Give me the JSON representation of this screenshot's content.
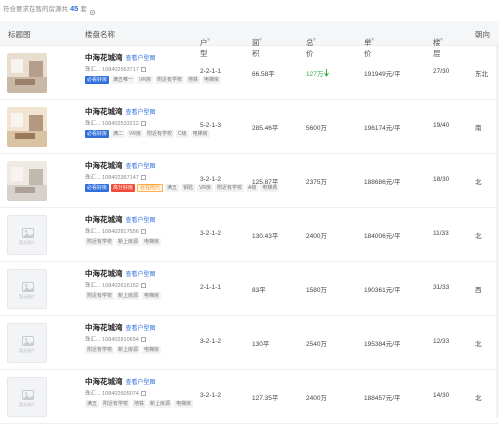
{
  "topbar": {
    "prefix": "符合要求在售的房源共",
    "count": "45",
    "suffix": "套"
  },
  "columns": {
    "image": "标题图",
    "name": "楼盘名称",
    "layout": "户型",
    "area": "面积",
    "total": "总价",
    "unit": "单价",
    "floor": "楼层",
    "orient": "朝向"
  },
  "layout_link_label": "查看户型图",
  "placeholder_label": "暂无图片",
  "listings": [
    {
      "name": "中海花城湾",
      "id": "珠汇... 108402563717",
      "layout": "2-2-1-1",
      "area": "66.58平",
      "total": "127万",
      "price_down": true,
      "unit": "191949元/平",
      "floor": "27/30",
      "orient": "东北",
      "image": "photo",
      "tags": [
        {
          "text": "必看好房",
          "style": "blue"
        },
        {
          "text": "满五唯一",
          "style": "plain"
        },
        {
          "text": "VR房",
          "style": "plain"
        },
        {
          "text": "附近有学校",
          "style": "plain"
        },
        {
          "text": "地铁",
          "style": "plain"
        },
        {
          "text": "电梯房",
          "style": "plain"
        }
      ]
    },
    {
      "name": "中海花城湾",
      "id": "珠汇... 108402533212",
      "layout": "5-2-1-3",
      "area": "285.46平",
      "total": "5600万",
      "price_down": false,
      "unit": "196174元/平",
      "floor": "19/40",
      "orient": "南",
      "image": "photo",
      "tags": [
        {
          "text": "必看好房",
          "style": "blue"
        },
        {
          "text": "满二",
          "style": "plain"
        },
        {
          "text": "VR房",
          "style": "plain"
        },
        {
          "text": "附近有学校",
          "style": "plain"
        },
        {
          "text": "C级",
          "style": "plain"
        },
        {
          "text": "电梯房",
          "style": "plain"
        }
      ]
    },
    {
      "name": "中海花城湾",
      "id": "珠汇... 108402367147",
      "layout": "3-2-1-2",
      "area": "125.87平",
      "total": "2375万",
      "price_down": false,
      "unit": "188686元/平",
      "floor": "18/30",
      "orient": "北",
      "image": "photo",
      "tags": [
        {
          "text": "必看好房",
          "style": "blue"
        },
        {
          "text": "高分好房",
          "style": "red"
        },
        {
          "text": "近在咫尺",
          "style": "orange"
        },
        {
          "text": "满五",
          "style": "plain"
        },
        {
          "text": "钥匙",
          "style": "plain"
        },
        {
          "text": "VR房",
          "style": "plain"
        },
        {
          "text": "附近有学校",
          "style": "plain"
        },
        {
          "text": "A级",
          "style": "plain"
        },
        {
          "text": "电梯房",
          "style": "plain"
        }
      ]
    },
    {
      "name": "中海花城湾",
      "id": "珠汇... 108402817556",
      "layout": "3-2-1-2",
      "area": "130.43平",
      "total": "2400万",
      "price_down": false,
      "unit": "184006元/平",
      "floor": "11/33",
      "orient": "北",
      "image": "placeholder",
      "tags": [
        {
          "text": "附近有学校",
          "style": "plain"
        },
        {
          "text": "新上房源",
          "style": "plain"
        },
        {
          "text": "电梯房",
          "style": "plain"
        }
      ]
    },
    {
      "name": "中海花城湾",
      "id": "珠汇... 108402616152",
      "layout": "2-1-1-1",
      "area": "83平",
      "total": "1580万",
      "price_down": false,
      "unit": "190361元/平",
      "floor": "31/33",
      "orient": "西",
      "image": "placeholder",
      "tags": [
        {
          "text": "附近有学校",
          "style": "plain"
        },
        {
          "text": "新上房源",
          "style": "plain"
        },
        {
          "text": "电梯房",
          "style": "plain"
        }
      ]
    },
    {
      "name": "中海花城湾",
      "id": "珠汇... 108402810654",
      "layout": "3-2-1-2",
      "area": "130平",
      "total": "2540万",
      "price_down": false,
      "unit": "195384元/平",
      "floor": "12/33",
      "orient": "北",
      "image": "placeholder",
      "tags": [
        {
          "text": "附近有学校",
          "style": "plain"
        },
        {
          "text": "新上房源",
          "style": "plain"
        },
        {
          "text": "电梯房",
          "style": "plain"
        }
      ]
    },
    {
      "name": "中海花城湾",
      "id": "珠汇... 108402605074",
      "layout": "3-2-1-2",
      "area": "127.35平",
      "total": "2400万",
      "price_down": false,
      "unit": "188457元/平",
      "floor": "14/30",
      "orient": "北",
      "image": "placeholder",
      "tags": [
        {
          "text": "满五",
          "style": "plain"
        },
        {
          "text": "附近有学校",
          "style": "plain"
        },
        {
          "text": "地铁",
          "style": "plain"
        },
        {
          "text": "新上房源",
          "style": "plain"
        },
        {
          "text": "电梯房",
          "style": "plain"
        }
      ]
    }
  ]
}
